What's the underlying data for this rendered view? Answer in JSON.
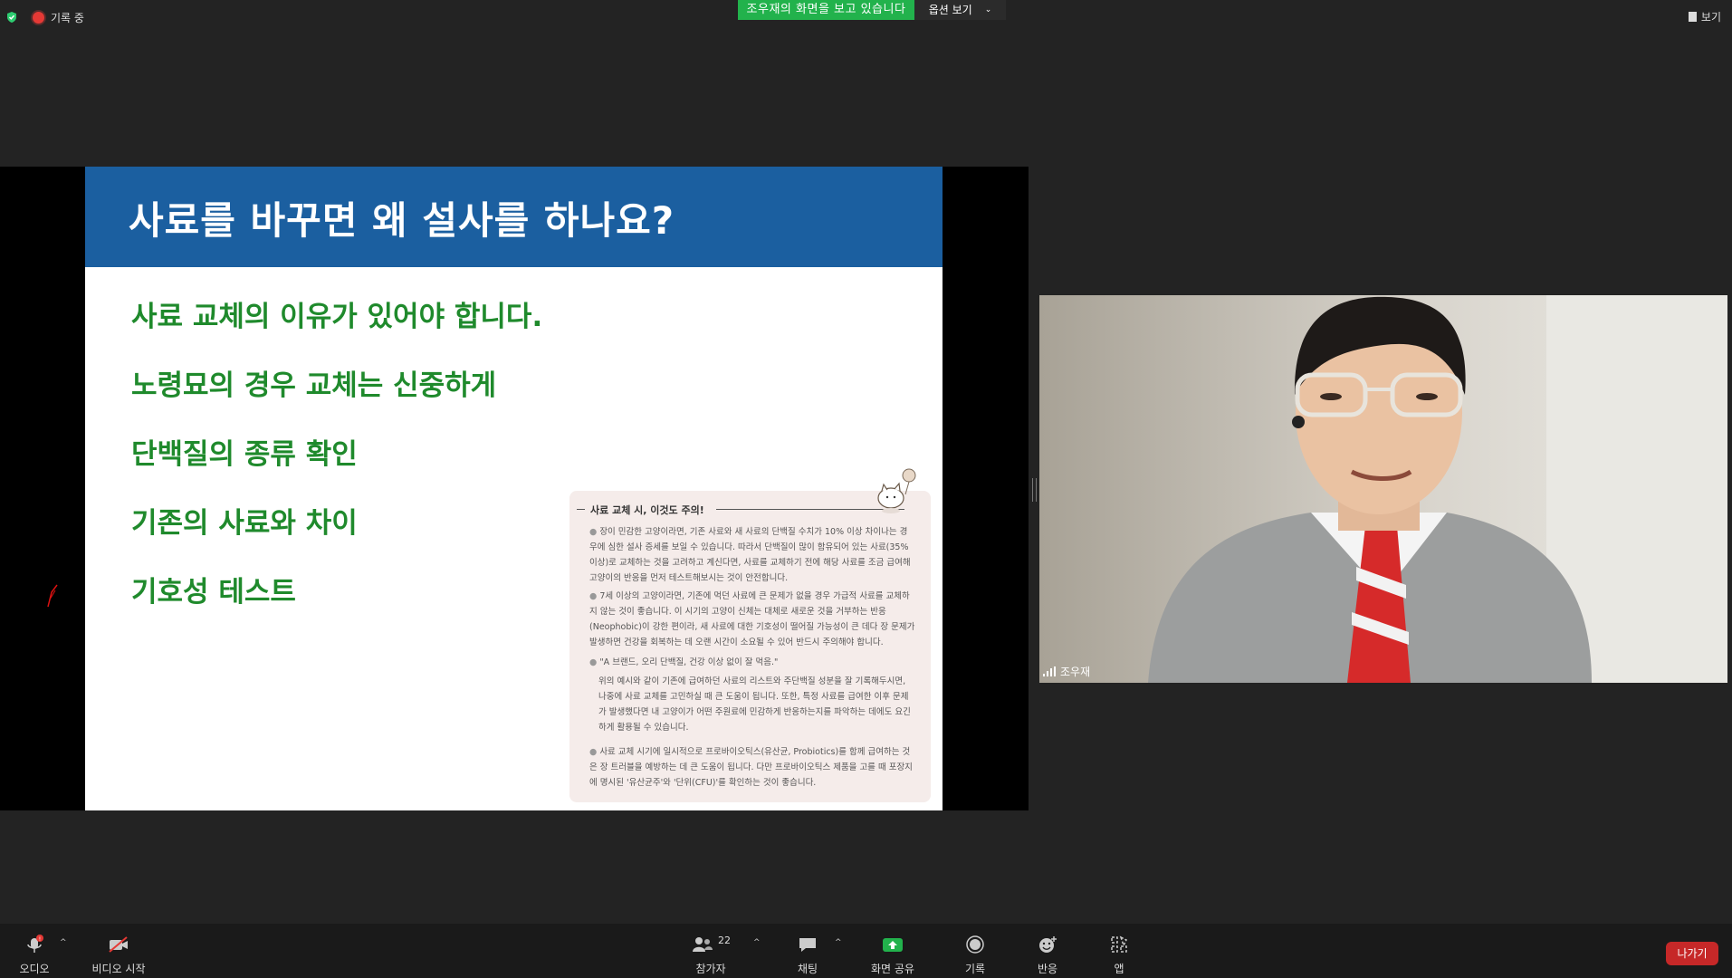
{
  "top_bar": {
    "recording_label": "기록 중",
    "sharing_banner": "조우재의 화면을 보고 있습니다",
    "view_options_label": "옵션 보기",
    "view_label": "보기"
  },
  "slide": {
    "title": "사료를 바꾸면 왜 설사를 하나요?",
    "points": [
      "사료 교체의 이유가 있어야 합니다.",
      "노령묘의 경우 교체는 신중하게",
      "단백질의 종류 확인",
      "기존의 사료와 차이",
      "기호성 테스트"
    ],
    "box": {
      "title": "사료 교체 시, 이것도 주의!",
      "bullets": [
        "장이 민감한 고양이라면, 기존 사료와 새 사료의 단백질 수치가 10% 이상 차이나는 경우에 심한 설사 증세를 보일 수 있습니다. 따라서 단백질이 많이 함유되어 있는 사료(35% 이상)로 교체하는 것을 고려하고 계신다면, 사료를 교체하기 전에 해당 사료를 조금 급여해 고양이의 반응을 먼저 테스트해보시는 것이 안전합니다.",
        "7세 이상의 고양이라면, 기존에 먹던 사료에 큰 문제가 없을 경우 가급적 사료를 교체하지 않는 것이 좋습니다. 이 시기의 고양이 신체는 대체로 새로운 것을 거부하는 반응(Neophobic)이 강한 편이라, 새 사료에 대한 기호성이 떨어질 가능성이 큰 데다 장 문제가 발생하면 건강을 회복하는 데 오랜 시간이 소요될 수 있어 반드시 주의해야 합니다.",
        "\"A 브랜드, 오리 단백질, 건강 이상 없이 잘 먹음.\"",
        "위의 예시와 같이 기존에 급여하던 사료의 리스트와 주단백질 성분을 잘 기록해두시면, 나중에 사료 교체를 고민하실 때 큰 도움이 됩니다. 또한, 특정 사료를 급여한 이후 문제가 발생했다면 내 고양이가 어떤 주원료에 민감하게 반응하는지를 파악하는 데에도 요긴하게 활용될 수 있습니다.",
        "사료 교체 시기에 일시적으로 프로바이오틱스(유산균, Probiotics)를 함께 급여하는 것은 장 트러블을 예방하는 데 큰 도움이 됩니다. 다만 프로바이오틱스 제품을 고를 때 포장지에 명시된 '유산균주'와 '단위(CFU)'를 확인하는 것이 좋습니다."
      ]
    }
  },
  "participant": {
    "name": "조우재"
  },
  "toolbar": {
    "audio": "오디오",
    "video": "비디오 시작",
    "participants": "참가자",
    "participants_count": "22",
    "chat": "채팅",
    "share_screen": "화면 공유",
    "record": "기록",
    "reactions": "반응",
    "apps": "앱",
    "leave": "나가기"
  },
  "colors": {
    "accent_green": "#22b24c",
    "slide_header_blue": "#1b5fa0",
    "slide_text_green": "#1f8a2c",
    "leave_red": "#c62828"
  }
}
